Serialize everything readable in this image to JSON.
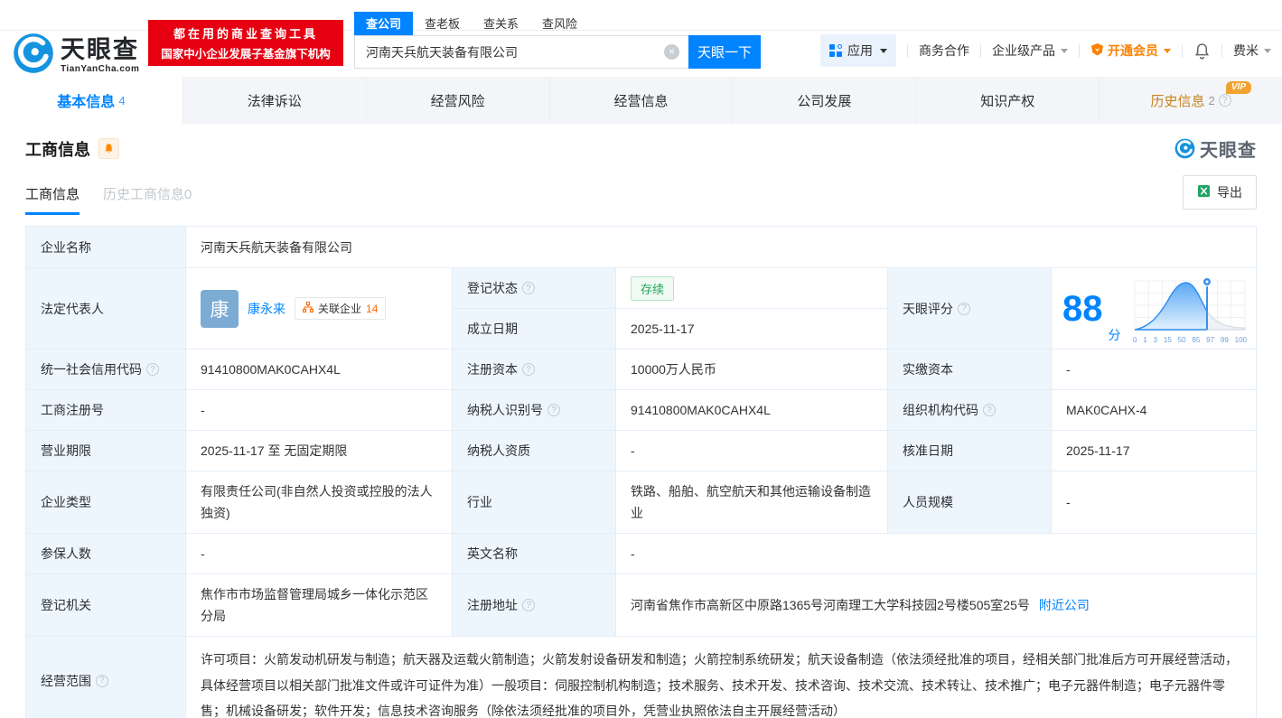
{
  "brand": {
    "name": "天眼查",
    "domain": "TianYanCha.com",
    "slogan_line1": "都在用的商业查询工具",
    "slogan_line2": "国家中小企业发展子基金旗下机构",
    "watermark": "天眼查"
  },
  "search": {
    "tabs": [
      "查公司",
      "查老板",
      "查关系",
      "查风险"
    ],
    "value": "河南天兵航天装备有限公司",
    "button_label": "天眼一下"
  },
  "topnav": {
    "apps": "应用",
    "cooperation": "商务合作",
    "enterprise_products": "企业级产品",
    "vip": "开通会员",
    "username": "费米"
  },
  "main_tabs": [
    {
      "label": "基本信息",
      "count": "4"
    },
    {
      "label": "法律诉讼"
    },
    {
      "label": "经营风险"
    },
    {
      "label": "经营信息"
    },
    {
      "label": "公司发展"
    },
    {
      "label": "知识产权"
    },
    {
      "label": "历史信息",
      "count": "2",
      "vip": "VIP"
    }
  ],
  "section": {
    "title": "工商信息",
    "subtab_active": "工商信息",
    "subtab_history": "历史工商信息",
    "subtab_history_count": "0",
    "export_label": "导出"
  },
  "fields": {
    "company_name": {
      "label": "企业名称",
      "value": "河南天兵航天装备有限公司"
    },
    "legal_rep": {
      "label": "法定代表人",
      "avatar": "康",
      "name": "康永来",
      "related_label": "关联企业",
      "related_count": "14"
    },
    "reg_status": {
      "label": "登记状态",
      "value": "存续"
    },
    "est_date": {
      "label": "成立日期",
      "value": "2025-11-17"
    },
    "credit_code": {
      "label": "统一社会信用代码",
      "value": "91410800MAK0CAHX4L"
    },
    "reg_capital": {
      "label": "注册资本",
      "value": "10000万人民币"
    },
    "paid_capital": {
      "label": "实缴资本",
      "value": "-"
    },
    "reg_number": {
      "label": "工商注册号",
      "value": "-"
    },
    "taxpayer_id": {
      "label": "纳税人识别号",
      "value": "91410800MAK0CAHX4L"
    },
    "org_code": {
      "label": "组织机构代码",
      "value": "MAK0CAHX-4"
    },
    "business_term": {
      "label": "营业期限",
      "value": "2025-11-17 至 无固定期限"
    },
    "taxpayer_quality": {
      "label": "纳税人资质",
      "value": "-"
    },
    "approval_date": {
      "label": "核准日期",
      "value": "2025-11-17"
    },
    "company_type": {
      "label": "企业类型",
      "value": "有限责任公司(非自然人投资或控股的法人独资)"
    },
    "industry": {
      "label": "行业",
      "value": "铁路、船舶、航空航天和其他运输设备制造业"
    },
    "staff_size": {
      "label": "人员规模",
      "value": "-"
    },
    "insured_count": {
      "label": "参保人数",
      "value": "-"
    },
    "english_name": {
      "label": "英文名称",
      "value": "-"
    },
    "reg_authority": {
      "label": "登记机关",
      "value": "焦作市市场监督管理局城乡一体化示范区分局"
    },
    "reg_address": {
      "label": "注册地址",
      "value": "河南省焦作市高新区中原路1365号河南理工大学科技园2号楼505室25号",
      "link": "附近公司"
    },
    "business_scope": {
      "label": "经营范围",
      "value": "许可项目：火箭发动机研发与制造；航天器及运载火箭制造；火箭发射设备研发和制造；火箭控制系统研发；航天设备制造（依法须经批准的项目，经相关部门批准后方可开展经营活动，具体经营项目以相关部门批准文件或许可证件为准）一般项目：伺服控制机构制造；技术服务、技术开发、技术咨询、技术交流、技术转让、技术推广；电子元器件制造；电子元器件零售；机械设备研发；软件开发；信息技术咨询服务（除依法须经批准的项目外，凭营业执照依法自主开展经营活动）"
    }
  },
  "score": {
    "label": "天眼评分",
    "value": "88",
    "unit": "分",
    "marker": 88,
    "axis": [
      "0",
      "1",
      "3",
      "15",
      "50",
      "85",
      "97",
      "99",
      "100"
    ]
  },
  "colors": {
    "primary": "#0084ff",
    "brand_red": "#e60012",
    "vip_orange": "#ff8000",
    "status_green": "#23a45a"
  }
}
